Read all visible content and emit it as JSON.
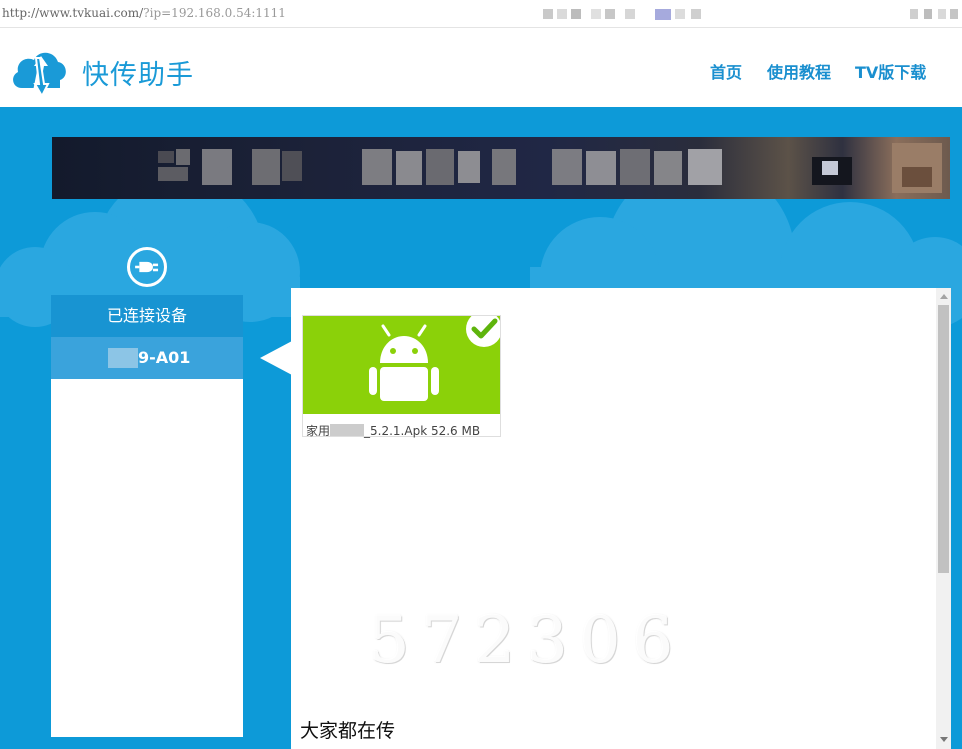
{
  "address_bar": {
    "url_host": "http://www.tvkuai.com/",
    "url_query": "?ip=192.168.0.54:1111"
  },
  "header": {
    "app_name": "快传助手",
    "logo_icon": "cloud-transfer-icon",
    "nav": [
      "首页",
      "使用教程",
      "TV版下载"
    ]
  },
  "sidebar": {
    "connect_icon": "plug-icon",
    "title": "已连接设备",
    "devices": [
      "9-A01"
    ]
  },
  "transfers": [
    {
      "icon": "android-icon",
      "status_icon": "check-icon",
      "name_prefix": "家用",
      "name_suffix": "_5.2.1.Apk 52.6 MB"
    }
  ],
  "watermark": "572306",
  "popular_heading": "大家都在传",
  "colors": {
    "brand_blue": "#0d9ad8",
    "header_text": "#1a9ad7",
    "panel_header": "#1894d2",
    "device_selected": "#3aa3dc",
    "android_green": "#8bd109"
  }
}
